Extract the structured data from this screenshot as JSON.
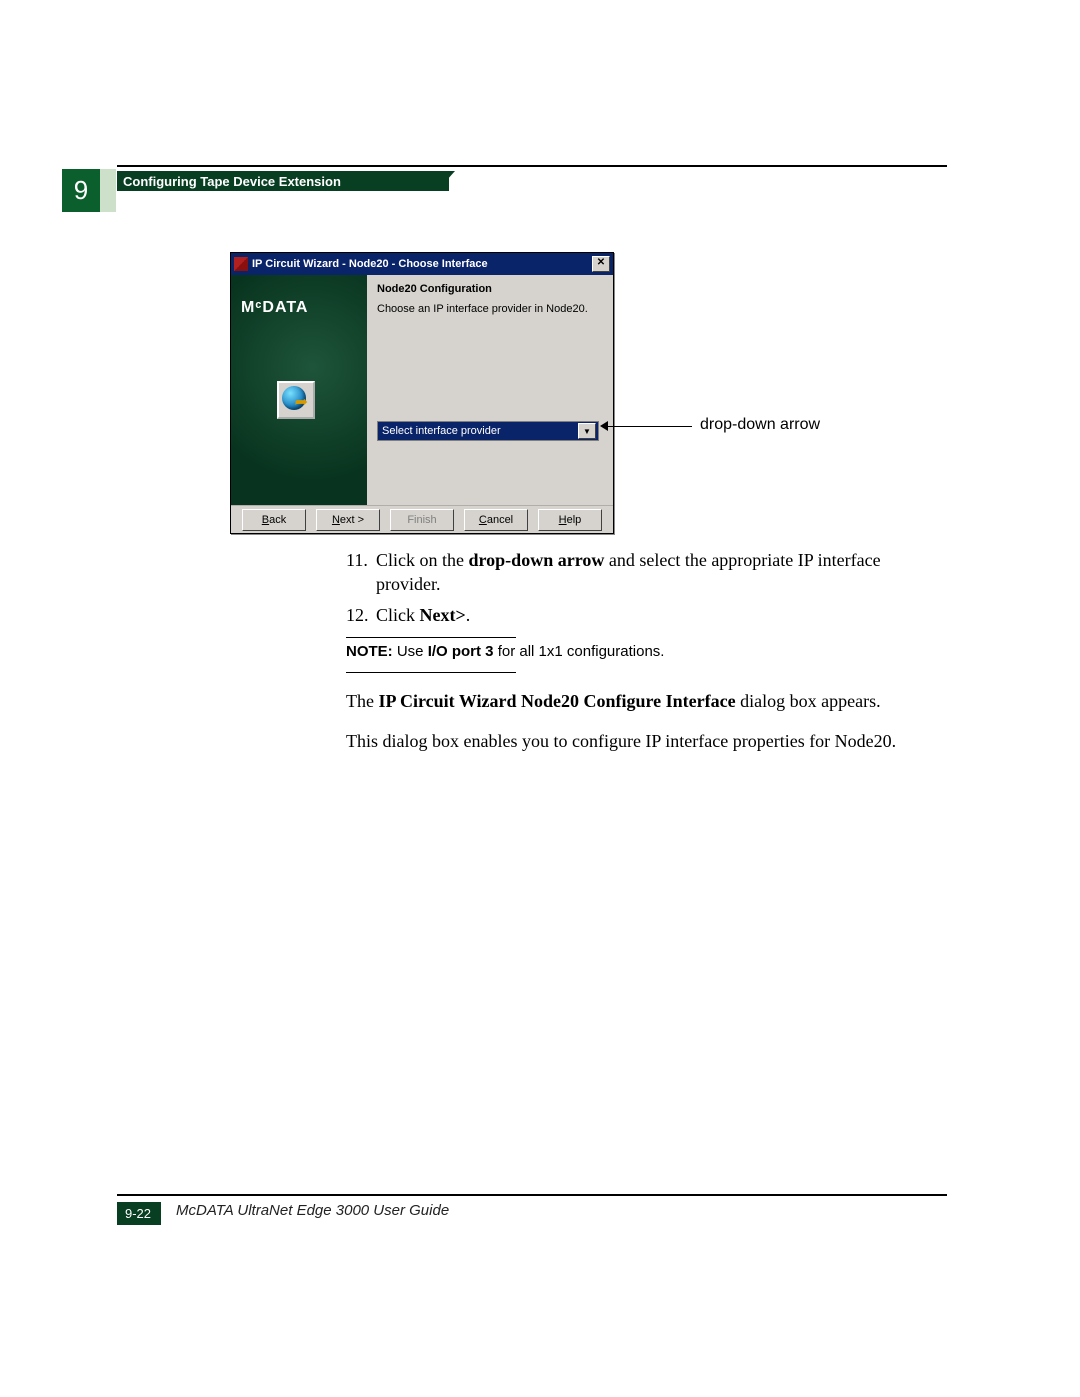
{
  "chapter": {
    "number": "9",
    "title": "Configuring Tape Device Extension"
  },
  "dialog": {
    "title": "IP Circuit Wizard - Node20 - Choose Interface",
    "brand": "MᶜDATA",
    "heading": "Node20 Configuration",
    "subheading": "Choose an IP interface provider in Node20.",
    "dropdown_value": "Select interface provider",
    "buttons": {
      "back": "< Back",
      "next": "Next >",
      "finish": "Finish",
      "cancel": "Cancel",
      "help": "Help"
    },
    "close_glyph": "✕"
  },
  "callout": {
    "label": "drop-down arrow"
  },
  "steps": {
    "s11_pre": "Click on the ",
    "s11_bold": "drop-down arrow",
    "s11_post": " and select the appropriate IP interface provider.",
    "s12_pre": "Click ",
    "s12_bold": "Next>",
    "s12_post": "."
  },
  "note": {
    "label": "NOTE:",
    "pre": " Use ",
    "bold": "I/O port 3",
    "post": " for all 1x1 configurations."
  },
  "paragraphs": {
    "p1_pre": "The ",
    "p1_bold": "IP Circuit Wizard Node20 Configure Interface",
    "p1_post": " dialog box appears.",
    "p2": "This dialog box enables you to configure IP interface properties for Node20."
  },
  "footer": {
    "page": "9-22",
    "guide": "McDATA UltraNet Edge 3000 User Guide"
  }
}
